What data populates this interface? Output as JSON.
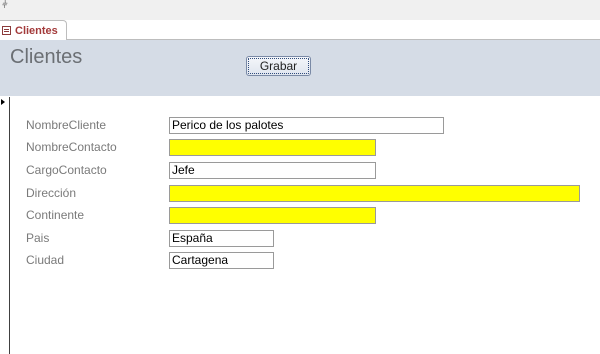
{
  "quick_access": {
    "icon": "dropdown-arrow-icon"
  },
  "tab": {
    "label": "Clientes",
    "icon": "form-icon"
  },
  "header": {
    "title": "Clientes",
    "save_button": "Grabar"
  },
  "form": {
    "fields": [
      {
        "label": "NombreCliente",
        "value": "Perico de los palotes",
        "highlight": false
      },
      {
        "label": "NombreContacto",
        "value": "",
        "highlight": true
      },
      {
        "label": "CargoContacto",
        "value": "Jefe",
        "highlight": false
      },
      {
        "label": "Dirección",
        "value": "",
        "highlight": true
      },
      {
        "label": "Continente",
        "value": "",
        "highlight": true
      },
      {
        "label": "Pais",
        "value": "España",
        "highlight": false
      },
      {
        "label": "Ciudad",
        "value": "Cartagena",
        "highlight": false
      }
    ]
  },
  "colors": {
    "highlight": "#ffff00",
    "header_bg": "#d5dce6",
    "tab_text": "#a33a3a"
  }
}
